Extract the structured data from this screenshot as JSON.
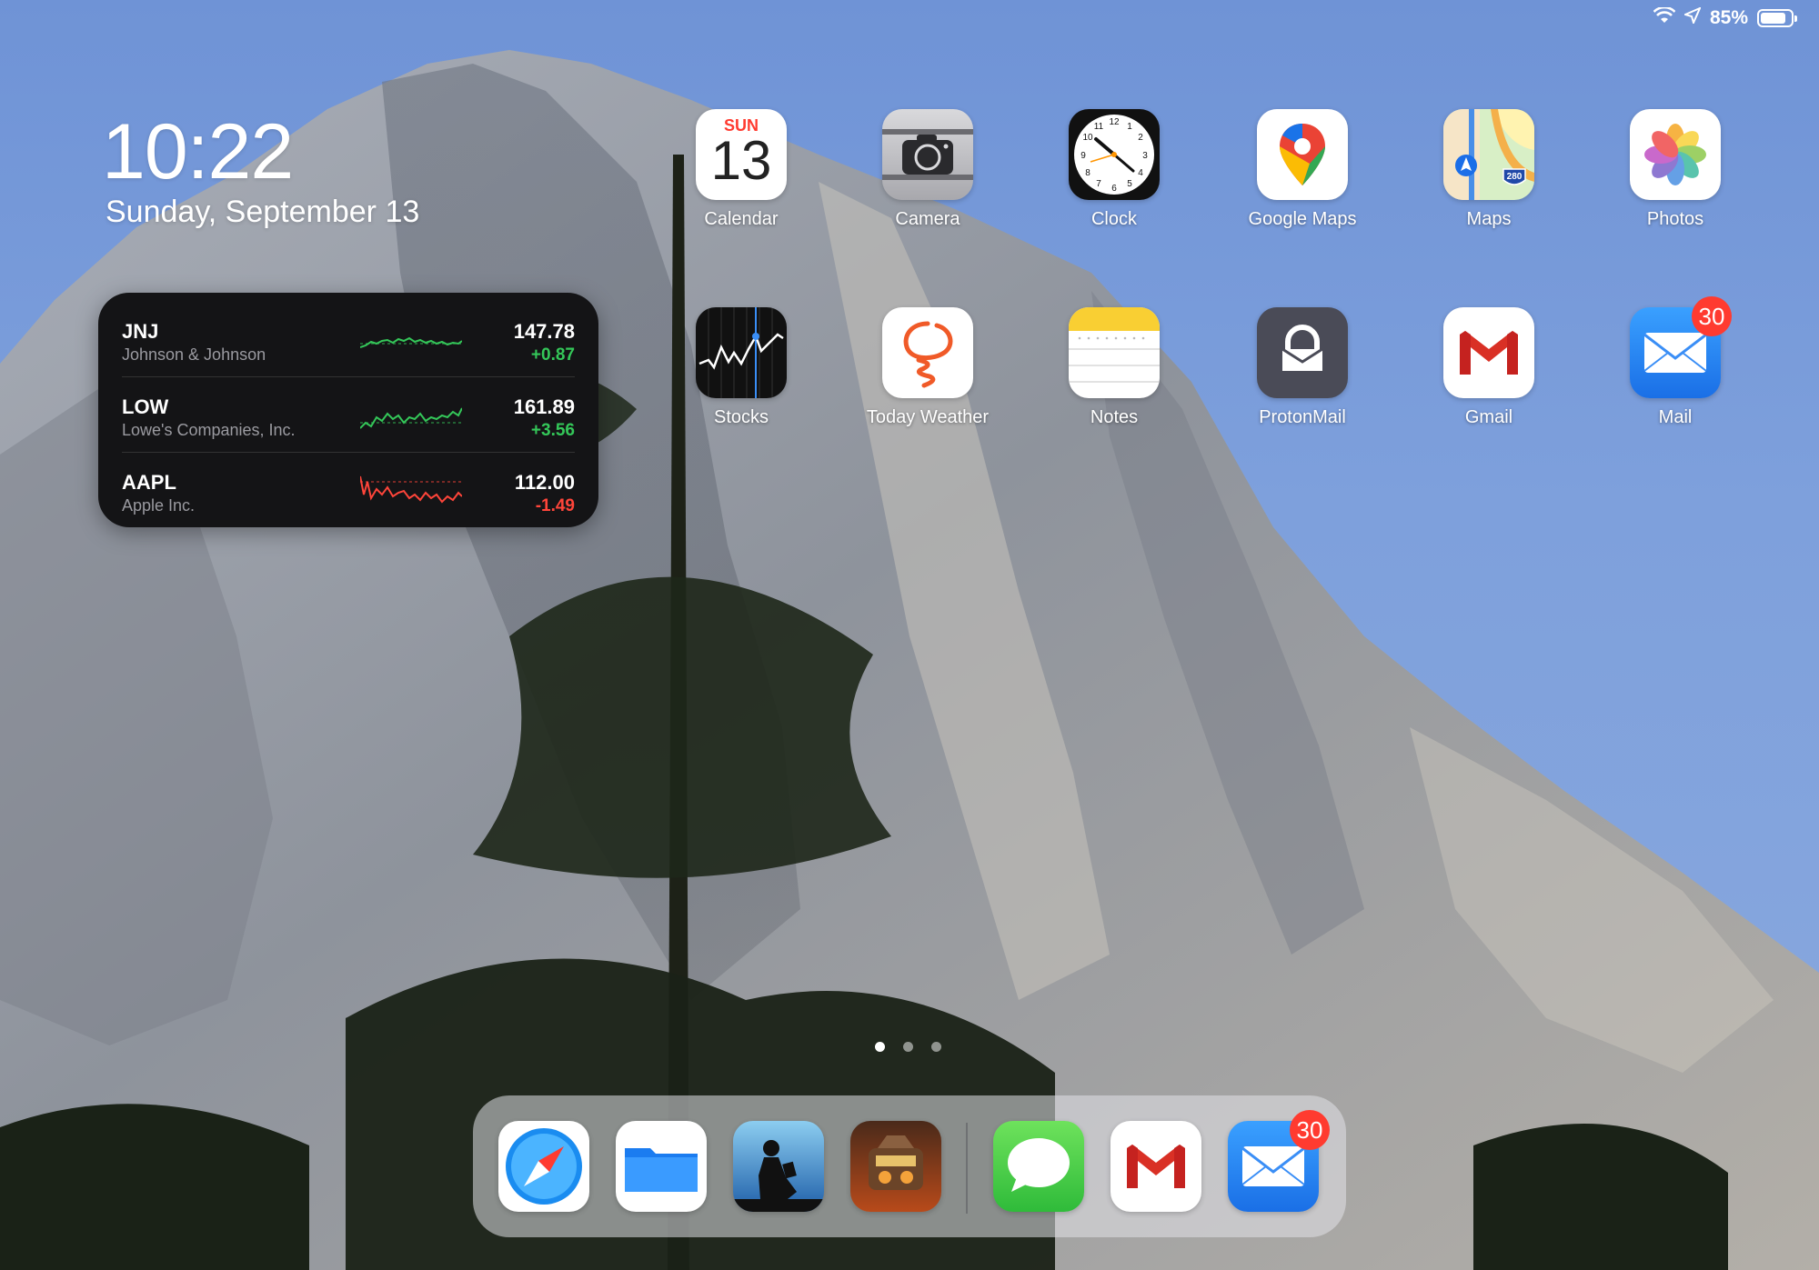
{
  "status_bar": {
    "battery_text": "85%",
    "battery_level": 0.85
  },
  "lock": {
    "time": "10:22",
    "date": "Sunday, September 13"
  },
  "stocks_widget": {
    "rows": [
      {
        "symbol": "JNJ",
        "name": "Johnson & Johnson",
        "price": "147.78",
        "change": "+0.87",
        "trend": "up"
      },
      {
        "symbol": "LOW",
        "name": "Lowe's Companies, Inc.",
        "price": "161.89",
        "change": "+3.56",
        "trend": "up"
      },
      {
        "symbol": "AAPL",
        "name": "Apple Inc.",
        "price": "112.00",
        "change": "-1.49",
        "trend": "down"
      }
    ]
  },
  "apps": {
    "calendar": {
      "label": "Calendar",
      "day": "SUN",
      "date": "13"
    },
    "camera": {
      "label": "Camera"
    },
    "clock": {
      "label": "Clock"
    },
    "google_maps": {
      "label": "Google Maps"
    },
    "maps": {
      "label": "Maps",
      "shield": "280"
    },
    "photos": {
      "label": "Photos"
    },
    "stocks": {
      "label": "Stocks"
    },
    "today_weather": {
      "label": "Today Weather"
    },
    "notes": {
      "label": "Notes"
    },
    "protonmail": {
      "label": "ProtonMail"
    },
    "gmail": {
      "label": "Gmail"
    },
    "mail": {
      "label": "Mail",
      "badge": "30"
    }
  },
  "dock": {
    "mail_badge": "30",
    "apps": [
      "safari-icon",
      "files-icon",
      "kindle-icon",
      "game-icon",
      "messages-icon",
      "gmail-icon",
      "mail-icon"
    ]
  },
  "page_dots": {
    "count": 3,
    "active": 1
  },
  "colors": {
    "up": "#34c759",
    "down": "#ff453a",
    "badge": "#ff3b30",
    "sky": "#7ea0dc"
  }
}
